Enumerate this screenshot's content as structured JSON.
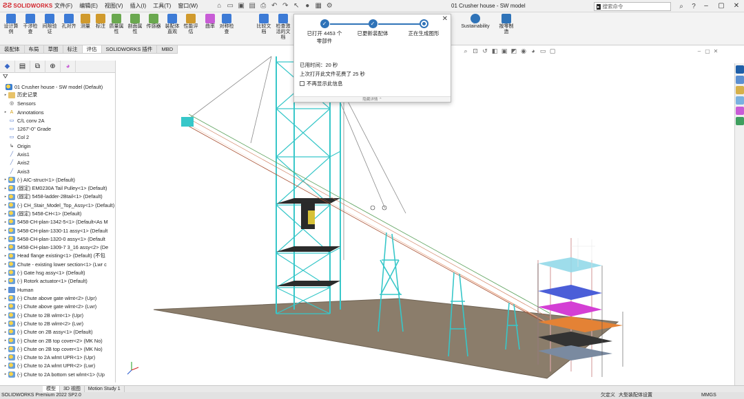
{
  "app": {
    "brand": "SOLIDWORKS",
    "document_title": "01 Crusher house - SW model",
    "search_placeholder": "搜索命令"
  },
  "menus": [
    "文件(F)",
    "编辑(E)",
    "视图(V)",
    "插入(I)",
    "工具(T)",
    "窗口(W)"
  ],
  "ribbon": {
    "buttons": [
      {
        "label": "设计算例",
        "color": "#3d7bd6"
      },
      {
        "label": "干涉检查",
        "color": "#3d7bd6"
      },
      {
        "label": "间隙验证",
        "color": "#3d7bd6"
      },
      {
        "label": "孔对齐",
        "color": "#3d7bd6"
      },
      {
        "label": "测量",
        "color": "#d09a2d"
      },
      {
        "label": "标注",
        "color": "#d09a2d"
      },
      {
        "label": "质量属性",
        "color": "#6aa84f"
      },
      {
        "label": "剖面属性",
        "color": "#6aa84f"
      },
      {
        "label": "传感器",
        "color": "#6aa84f"
      },
      {
        "label": "装配体直观",
        "color": "#3d7bd6"
      },
      {
        "label": "性能评估",
        "color": "#d09a2d"
      },
      {
        "label": "曲率",
        "color": "#c85cd6"
      },
      {
        "label": "对称检查",
        "color": "#3d7bd6"
      },
      {
        "label": "比较文档",
        "color": "#3d7bd6"
      },
      {
        "label": "检查激活的文档",
        "color": "#3d7bd6"
      },
      {
        "label": "Sustainability",
        "color": "#2f73b8"
      },
      {
        "label": "按零制造",
        "color": "#2f73b8"
      }
    ]
  },
  "command_tabs": [
    {
      "label": "装配体",
      "active": false
    },
    {
      "label": "布局",
      "active": false
    },
    {
      "label": "草图",
      "active": false
    },
    {
      "label": "标注",
      "active": false
    },
    {
      "label": "评估",
      "active": true
    },
    {
      "label": "SOLIDWORKS 插件",
      "active": false
    },
    {
      "label": "MBD",
      "active": false
    }
  ],
  "tree": {
    "root": "01 Crusher house - SW model  (Default)",
    "items": [
      {
        "label": "历史记录",
        "icon": "folder",
        "expand": "▸"
      },
      {
        "label": "Sensors",
        "icon": "sensor",
        "expand": ""
      },
      {
        "label": "Annotations",
        "icon": "annot",
        "expand": "▸"
      },
      {
        "label": "C/L conv 2A",
        "icon": "sketch",
        "expand": ""
      },
      {
        "label": "1267'-0\" Grade",
        "icon": "sketch",
        "expand": ""
      },
      {
        "label": "Col 2",
        "icon": "sketch",
        "expand": ""
      },
      {
        "label": "Origin",
        "icon": "origin",
        "expand": ""
      },
      {
        "label": "Axis1",
        "icon": "axis",
        "expand": ""
      },
      {
        "label": "Axis2",
        "icon": "axis",
        "expand": ""
      },
      {
        "label": "Axis3",
        "icon": "axis",
        "expand": ""
      },
      {
        "label": "(-) AIC-struct<1> (Default)",
        "icon": "part",
        "expand": "▸"
      },
      {
        "label": "(固定) EM0230A Tail Pulley<1> (Default)",
        "icon": "part",
        "expand": "▸"
      },
      {
        "label": "(固定) 5458-ladder-2Btail<1> (Default)",
        "icon": "part",
        "expand": "▸"
      },
      {
        "label": "(-) CH_Stair_Model_Top_Assy<1> (Default)",
        "icon": "part",
        "expand": "▸"
      },
      {
        "label": "(固定) 5458-CH<1> (Default)",
        "icon": "part",
        "expand": "▸"
      },
      {
        "label": "5458-CH-plan-1342-5<1> (Default<As M",
        "icon": "part",
        "expand": "▸"
      },
      {
        "label": "5458-CH-plan-1330-11 assy<1> (Default",
        "icon": "part",
        "expand": "▸"
      },
      {
        "label": "5458-CH-plan-1320-0 assy<1> (Default",
        "icon": "part",
        "expand": "▸"
      },
      {
        "label": "5458-CH-plan-1309-7 3_16 assy<2> (De",
        "icon": "part",
        "expand": "▸"
      },
      {
        "label": "Head flange existing<1> (Default) (不包",
        "icon": "part",
        "expand": "▸"
      },
      {
        "label": "Chute - existing lower section<1> (Lwr c",
        "icon": "part",
        "expand": "▸"
      },
      {
        "label": "(-) Gate hsg assy<1> (Default)",
        "icon": "part",
        "expand": "▸"
      },
      {
        "label": "(-) Rotork actuator<1> (Default)",
        "icon": "part",
        "expand": "▸"
      },
      {
        "label": "Human",
        "icon": "human",
        "expand": "▸"
      },
      {
        "label": "(-) Chute above gate wlmt<2> (Upr)",
        "icon": "part",
        "expand": "▸"
      },
      {
        "label": "(-) Chute above gate wlmt<2> (Lwr)",
        "icon": "part",
        "expand": "▸"
      },
      {
        "label": "(-) Chute to 2B wlmt<1> (Upr)",
        "icon": "part",
        "expand": "▸"
      },
      {
        "label": "(-) Chute to 2B wlmt<2> (Lwr)",
        "icon": "part",
        "expand": "▸"
      },
      {
        "label": "(-) Chute on 2B assy<1> (Default)",
        "icon": "part",
        "expand": "▸"
      },
      {
        "label": "(-) Chute on 2B top cover<2> (MK No)",
        "icon": "part",
        "expand": "▸"
      },
      {
        "label": "(-) Chute on 2B top cover<1> (MK No)",
        "icon": "part",
        "expand": "▸"
      },
      {
        "label": "(-) Chute to 2A wlmt UPR<1> (Upr)",
        "icon": "part",
        "expand": "▸"
      },
      {
        "label": "(-) Chute to 2A wlmt UPR<2> (Lwr)",
        "icon": "part",
        "expand": "▸"
      },
      {
        "label": "(-) Chute to 2A bottom set wlmt<1> (Up",
        "icon": "part",
        "expand": "▸"
      }
    ]
  },
  "popup": {
    "steps": [
      "已打开 4453 个零部件",
      "已更新装配体",
      "正在生成图形"
    ],
    "elapsed": "已用时间：20 秒",
    "last_open": "上次打开此文件花费了 25 秒",
    "dont_show": "不再显示此信息",
    "footer": "隐藏详情"
  },
  "bottom_tabs": [
    {
      "label": "模型",
      "active": true
    },
    {
      "label": "3D 视图",
      "active": false
    },
    {
      "label": "Motion Study 1",
      "active": false
    }
  ],
  "status": {
    "left": "SOLIDWORKS Premium 2022 SP2.0",
    "mid1": "欠定义",
    "mid2": "大型装配体设置",
    "units": "MMGS"
  },
  "colors": {
    "tower": "#37c7c9",
    "conveyor": "#c96d4a",
    "ground": "#8b7d6b",
    "accent": "#2f73b8"
  }
}
